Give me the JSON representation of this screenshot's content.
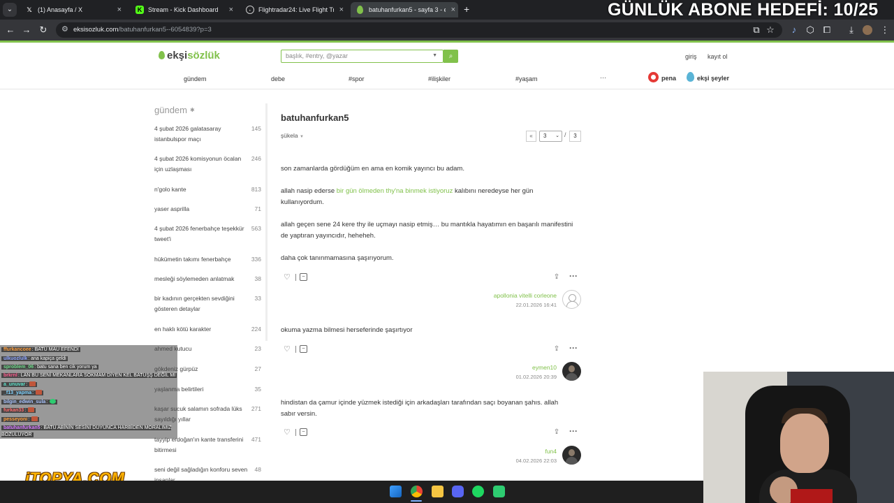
{
  "overlay": {
    "goal_text": "GÜNLÜK ABONE HEDEFİ: 10/25",
    "sponsor_logo": "iTOPYA.COM"
  },
  "browser": {
    "tabs": [
      {
        "label": "(1) Anasayfa / X",
        "icon": "x-logo-icon"
      },
      {
        "label": "Stream - Kick Dashboard",
        "icon": "kick-logo-icon"
      },
      {
        "label": "Flightradar24: Live Flight Tracke",
        "icon": "flightradar-icon"
      },
      {
        "label": "batuhanfurkan5 - sayfa 3 - ekşi",
        "icon": "eksi-drop-icon",
        "active": true
      }
    ],
    "new_tab_label": "+",
    "url_host": "eksisozluk.com",
    "url_path": "/batuhanfurkan5--6054839?p=3"
  },
  "site": {
    "logo_prefix": "ekşi",
    "logo_suffix": "sözlük",
    "search_placeholder": "başlık, #entry, @yazar",
    "login": "giriş",
    "register": "kayıt ol",
    "nav": [
      "gündem",
      "debe",
      "#spor",
      "#ilişkiler",
      "#yaşam",
      "···"
    ],
    "pena": "pena",
    "seyler": "ekşi şeyler"
  },
  "sidebar": {
    "title": "gündem",
    "items": [
      {
        "label": "4 şubat 2026 galatasaray istanbulspor maçı",
        "count": "145"
      },
      {
        "label": "4 şubat 2026 komisyonun öcalan için uzlaşması",
        "count": "246"
      },
      {
        "label": "n'golo kante",
        "count": "813"
      },
      {
        "label": "yaser asprilla",
        "count": "71"
      },
      {
        "label": "4 şubat 2026 fenerbahçe teşekkür tweet'i",
        "count": "563"
      },
      {
        "label": "hükümetin takımı fenerbahçe",
        "count": "336"
      },
      {
        "label": "mesleği söylemeden anlatmak",
        "count": "38"
      },
      {
        "label": "bir kadının gerçekten sevdiğini gösteren detaylar",
        "count": "33"
      },
      {
        "label": "en haklı kötü karakter",
        "count": "224"
      },
      {
        "label": "ahmed kutucu",
        "count": "23"
      },
      {
        "label": "gökdeniz gürpüz",
        "count": "27"
      },
      {
        "label": "yaşlanma belirtileri",
        "count": "35"
      },
      {
        "label": "kaşar sucuk salamın sofrada lüks sayıldığı yıllar",
        "count": "271"
      },
      {
        "label": "tayyip erdoğan'ın kante transferini bitirmesi",
        "count": "471"
      },
      {
        "label": "seni değil sağladığın konforu seven insanlar",
        "count": "48"
      }
    ]
  },
  "topic": {
    "title": "batuhanfurkan5",
    "sort": "şükela",
    "pager": {
      "prev": "«",
      "current": "3",
      "slash": "/",
      "total": "3"
    }
  },
  "entries": [
    {
      "paragraphs": [
        {
          "text": "son zamanlarda gördüğüm en ama en komik yayıncı bu adam."
        },
        {
          "before": "allah nasip ederse ",
          "link": "bir gün ölmeden thy'na binmek istiyoruz",
          "after": " kalıbını neredeyse her gün kullanıyordum."
        },
        {
          "text": "allah geçen sene 24 kere thy ile uçmayı nasip etmiş… bu mantıkla hayatımın en başarılı manifestini de yaptıran yayıncıdır, heheheh."
        },
        {
          "text": "daha çok tanınmamasına şaşırıyorum."
        }
      ],
      "author": "apollonia vitelli corleone",
      "date": "22.01.2026 16:41"
    },
    {
      "paragraphs": [
        {
          "text": "okuma yazma bilmesi herseferinde şaşırtıyor"
        }
      ],
      "author": "eymen10",
      "date": "01.02.2026 20:39"
    },
    {
      "paragraphs": [
        {
          "text": "hindistan da çamur içinde yüzmek istediği için arkadaşları tarafından saçı boyanan şahıs. allah sabır versin."
        }
      ],
      "author": "fun4",
      "date": "04.02.2026 22:03"
    }
  ],
  "chat": [
    {
      "user": "ffurkancoee",
      "msg": "BATU MAU EFENDI",
      "color": "#ff9e3d"
    },
    {
      "user": "ulkuozlulk",
      "msg": "ana kapiça geldi",
      "color": "#8fa6ff"
    },
    {
      "user": "sproblem_06",
      "msg": "batu sana ben cik yorum ya",
      "color": "#6fdc8c"
    },
    {
      "user": "brkrnl",
      "msg": "LAN BU SENİ MEKANLARA SOKMAM DİYEN KEL BATUŞŞ DEĞİL Mİ",
      "color": "#ff5d8f"
    },
    {
      "user": "a_unuvar",
      "msg": "",
      "color": "#5ee0c9"
    },
    {
      "user": "_f13_yapma",
      "msg": "",
      "color": "#7fd3ff"
    },
    {
      "user": "bilgin_edwin_sula",
      "msg": "",
      "color": "#a9c4ff"
    },
    {
      "user": "furkan33",
      "msg": "",
      "color": "#ff6b6b"
    },
    {
      "user": "pesseyoni",
      "msg": "",
      "color": "#ff9e3d"
    },
    {
      "user": "batuhanfurkan5",
      "msg": "BATU ABİNİN SESİNİ DUYUNCA HARBİDEN MORALIMIZ BOZULUYOR",
      "color": "#d77bff"
    }
  ]
}
